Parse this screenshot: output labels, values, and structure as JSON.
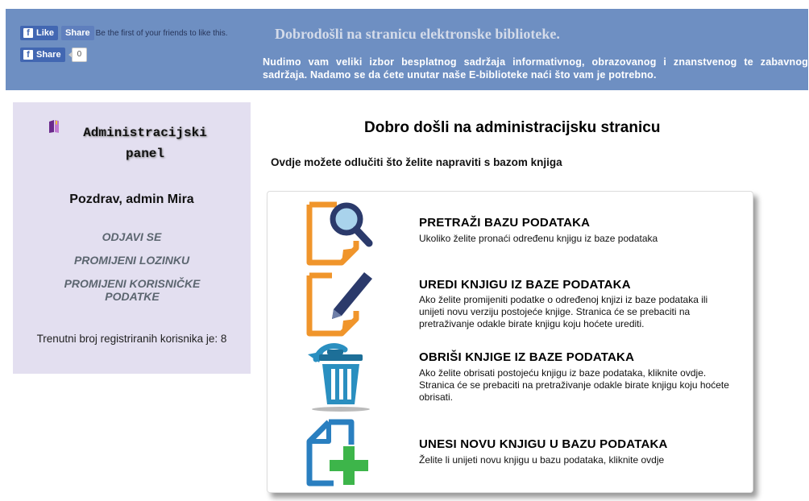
{
  "facebook": {
    "like_label": "Like",
    "share_label": "Share",
    "social_text": "Be the first of your friends to like this.",
    "share2_label": "Share",
    "share_count": "0"
  },
  "header": {
    "title": "Dobrodošli na stranicu elektronske biblioteke.",
    "text": "Nudimo vam veliki izbor besplatnog sadržaja informativnog, obrazovanog i znanstvenog te zabavnog sadržaja. Nadamo se da ćete unutar naše E-biblioteke naći što vam je potrebno."
  },
  "sidebar": {
    "title": "Administracijski panel",
    "greeting": "Pozdrav, admin Mira",
    "links": [
      "ODJAVI SE",
      "PROMIJENI LOZINKU",
      "PROMIJENI KORISNIČKE PODATKE"
    ],
    "user_count": "Trenutni broj registriranih korisnika je: 8"
  },
  "main": {
    "title": "Dobro došli na administracijsku stranicu",
    "subtitle": "Ovdje možete odlučiti što želite napraviti s bazom knjiga",
    "items": [
      {
        "title": "PRETRAŽI BAZU PODATAKA",
        "desc": "Ukoliko želite pronaći određenu knjigu iz baze podataka",
        "icon": "search-document-icon"
      },
      {
        "title": "UREDI KNJIGU IZ BAZE PODATAKA",
        "desc": "Ako želite promijeniti podatke o određenoj knjizi iz baze podataka ili unijeti novu verziju postojeće knjige. Stranica će se prebaciti na pretraživanje odakle birate knjigu koju hoćete urediti.",
        "icon": "edit-document-icon"
      },
      {
        "title": "OBRIŠI KNJIGE IZ BAZE PODATAKA",
        "desc": "Ako želite obrisati postojeću knjigu iz baze podataka, kliknite ovdje. Stranica će se prebaciti na pretraživanje odakle birate knjigu koju hoćete obrisati.",
        "icon": "trash-icon"
      },
      {
        "title": "UNESI NOVU KNJIGU U BAZU PODATAKA",
        "desc": "Želite li unijeti novu knjigu u bazu podataka, kliknite ovdje",
        "icon": "add-document-icon"
      }
    ]
  },
  "colors": {
    "header_bg": "#6e8fc2",
    "sidebar_bg": "#e3dff0",
    "orange": "#f0952b",
    "navy": "#2b3a6b",
    "teal": "#2a8fc0",
    "green": "#3db54a"
  }
}
